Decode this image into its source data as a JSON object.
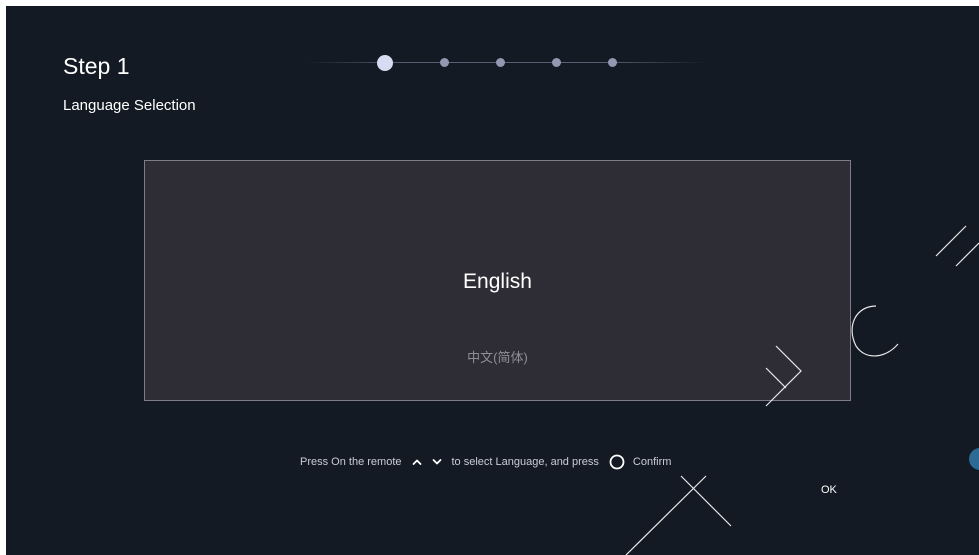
{
  "step": {
    "title": "Step 1",
    "subtitle": "Language Selection"
  },
  "progress": {
    "total_steps": 5,
    "current_step": 1
  },
  "languages": {
    "selected": "English",
    "other": "中文(简体)"
  },
  "hint": {
    "prefix": "Press On the remote",
    "middle": "to select Language, and press",
    "suffix": "Confirm",
    "up_icon": "chevron-up-icon",
    "down_icon": "chevron-down-icon",
    "confirm_icon": "circle-icon"
  },
  "ok": {
    "label": "OK"
  },
  "colors": {
    "background": "#141a23",
    "panel": "#2e2d35",
    "active_dot": "#d8dcf2",
    "inactive_dot": "#9497b0",
    "badge": "#2b6b96"
  }
}
